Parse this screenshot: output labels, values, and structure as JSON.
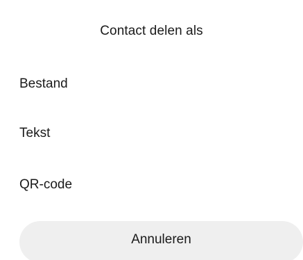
{
  "dialog": {
    "title": "Contact delen als",
    "options": [
      {
        "label": "Bestand"
      },
      {
        "label": "Tekst"
      },
      {
        "label": "QR-code"
      }
    ],
    "cancel_label": "Annuleren"
  }
}
